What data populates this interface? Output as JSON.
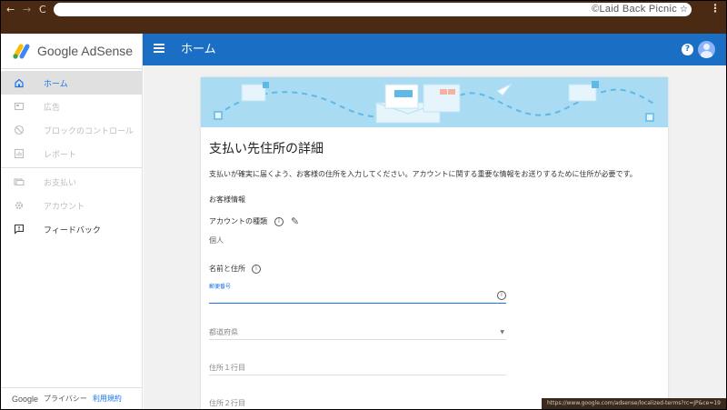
{
  "browser": {
    "watermark": "©Laid Back Picnic",
    "back": "←",
    "forward": "→",
    "reload": "C",
    "star": "☆",
    "menu": "⋮",
    "status_url": "https://www.google.com/adsense/localized-terms?rc=JP&ce=19"
  },
  "sidebar": {
    "logo_text": "Google AdSense",
    "items": [
      {
        "label": "ホーム",
        "icon": "home-icon",
        "state": "active"
      },
      {
        "label": "広告",
        "icon": "ads-icon",
        "state": "disabled"
      },
      {
        "label": "ブロックのコントロール",
        "icon": "block-icon",
        "state": "disabled"
      },
      {
        "label": "レポート",
        "icon": "report-icon",
        "state": "disabled"
      },
      {
        "label": "お支払い",
        "icon": "payment-icon",
        "state": "disabled"
      },
      {
        "label": "アカウント",
        "icon": "gear-icon",
        "state": "disabled"
      },
      {
        "label": "フィードバック",
        "icon": "feedback-icon",
        "state": "enabled"
      }
    ],
    "footer": {
      "google": "Google",
      "privacy": "プライバシー",
      "terms": "利用規約"
    }
  },
  "appbar": {
    "title": "ホーム",
    "help": "?"
  },
  "card": {
    "title": "支払い先住所の詳細",
    "description": "支払いが確実に届くよう、お客様の住所を入力してください。アカウントに関する重要な情報をお送りするために住所が必要です。",
    "customer_info_label": "お客様情報",
    "account_type_label": "アカウントの種類",
    "account_type_value": "個人",
    "name_address_label": "名前と住所",
    "postal_label": "郵便番号",
    "prefecture_placeholder": "都道府県",
    "address1_placeholder": "住所１行目",
    "address2_placeholder": "住所２行目",
    "info_glyph": "i",
    "pencil_glyph": "✎",
    "dropdown_glyph": "▼"
  },
  "colors": {
    "appbar": "#1a6fc4",
    "accent": "#1a73e8",
    "banner": "#a9dcf3",
    "chrome": "#4a2a12"
  }
}
